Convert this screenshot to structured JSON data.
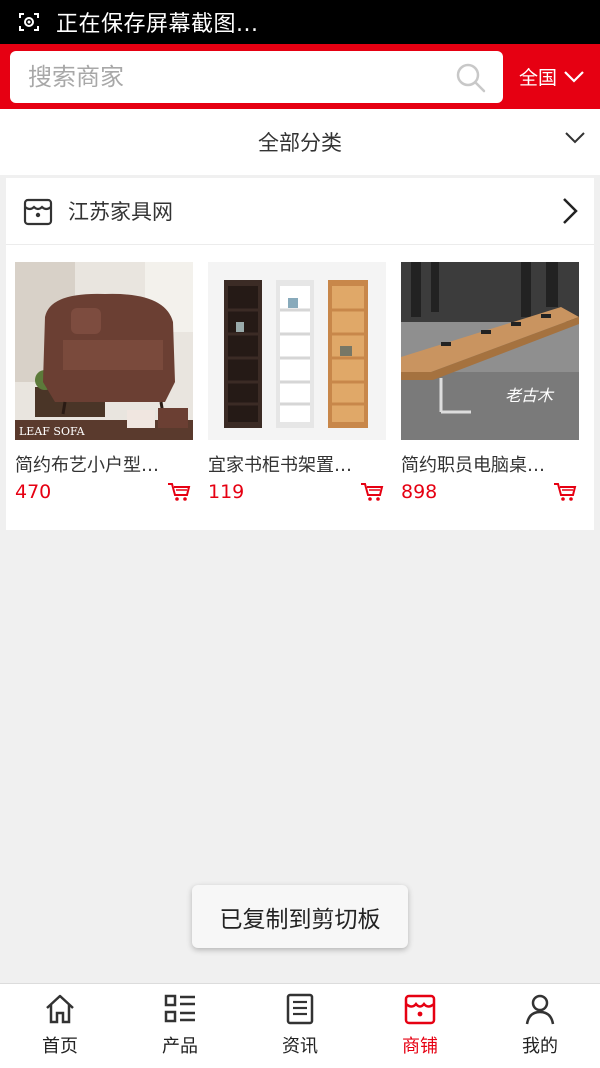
{
  "status_bar": {
    "text": "正在保存屏幕截图..."
  },
  "header": {
    "search_placeholder": "搜索商家",
    "region_label": "全国"
  },
  "category_bar": {
    "label": "全部分类"
  },
  "shop": {
    "name": "江苏家具网",
    "products": [
      {
        "name": "简约布艺小户型…",
        "price": "470",
        "image": "brown-sofa-image"
      },
      {
        "name": "宜家书柜书架置…",
        "price": "119",
        "image": "bookshelves-image"
      },
      {
        "name": "简约职员电脑桌…",
        "price": "898",
        "image": "office-desk-image"
      }
    ],
    "sofa_caption": "LEAF SOFA",
    "desk_watermark": "老古木"
  },
  "toast": {
    "text": "已复制到剪切板"
  },
  "bottom_nav": {
    "items": [
      {
        "label": "首页",
        "icon": "home-icon"
      },
      {
        "label": "产品",
        "icon": "product-list-icon"
      },
      {
        "label": "资讯",
        "icon": "news-icon"
      },
      {
        "label": "商铺",
        "icon": "store-icon",
        "active": true
      },
      {
        "label": "我的",
        "icon": "user-icon"
      }
    ]
  },
  "colors": {
    "accent": "#e60012",
    "background": "#f0f0f0"
  }
}
